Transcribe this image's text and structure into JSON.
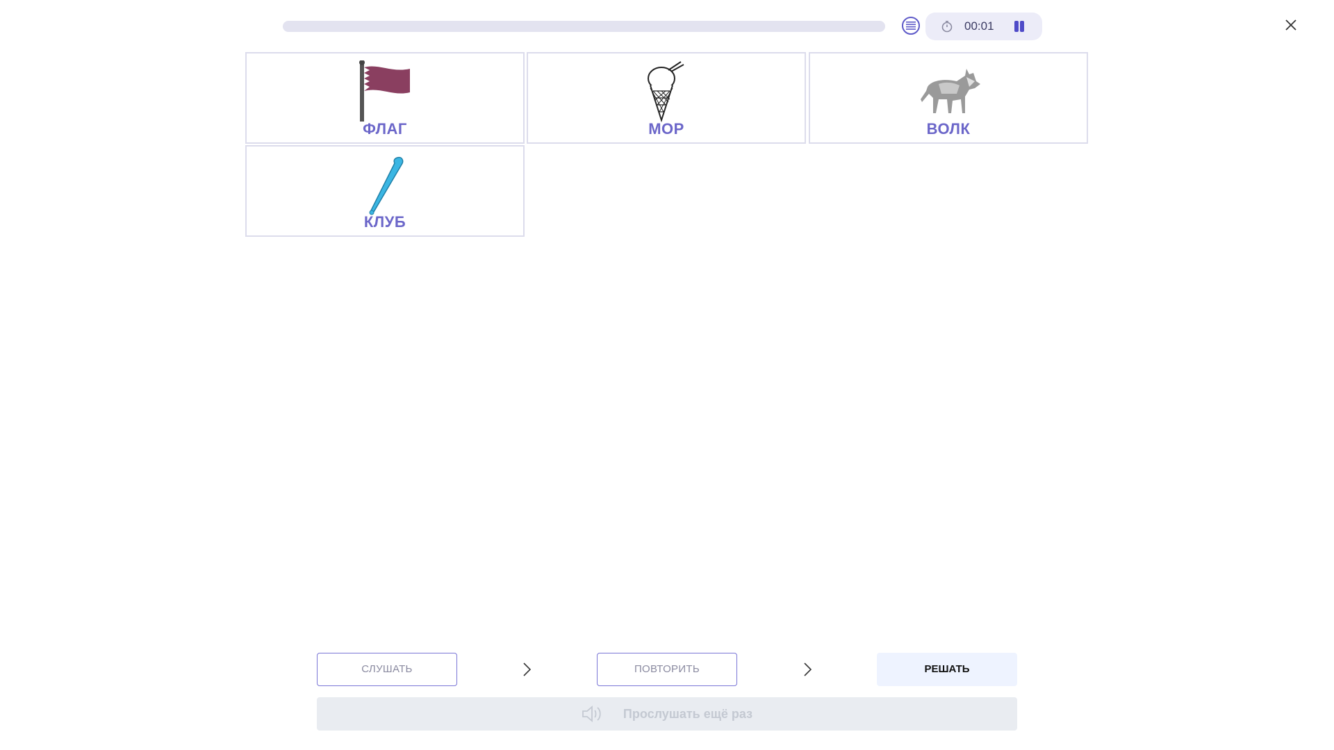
{
  "header": {
    "progress": 0,
    "timer": "00:01",
    "icons": {
      "menu": "list-icon",
      "timer": "stopwatch-icon",
      "pause": "pause-icon",
      "close": "close-icon"
    }
  },
  "cards": [
    {
      "label": "ФЛАГ",
      "icon": "flag-image"
    },
    {
      "label": "МОР",
      "icon": "ice-cream-image"
    },
    {
      "label": "ВОЛК",
      "icon": "wolf-image"
    },
    {
      "label": "КЛУБ",
      "icon": "club-image"
    }
  ],
  "steps": {
    "listen": "СЛУШАТЬ",
    "repeat": "ПОВТОРИТЬ",
    "solve": "РЕШАТЬ"
  },
  "listen_again": "Прослушать ещё раз",
  "colors": {
    "accent": "#6b66c9",
    "card_border": "#dcdcec",
    "progress_track": "#e3e3f0"
  }
}
